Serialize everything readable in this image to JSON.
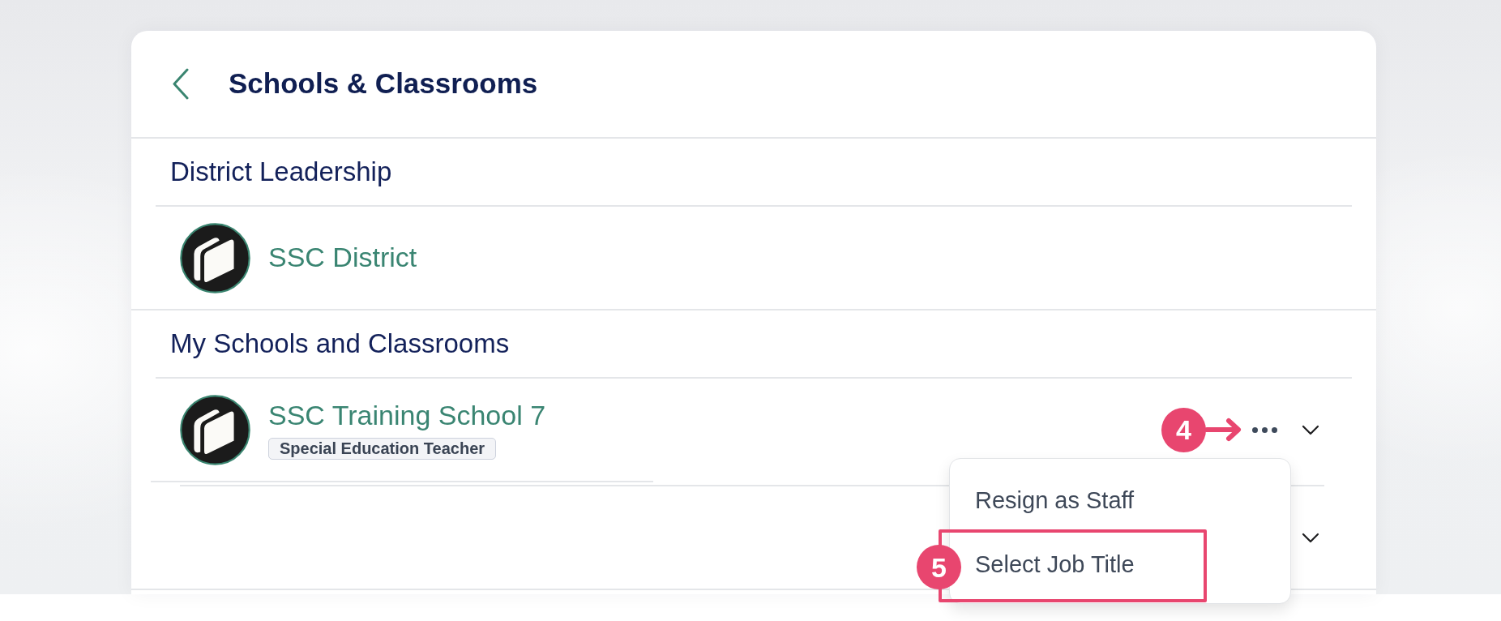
{
  "header": {
    "title": "Schools & Classrooms"
  },
  "sections": [
    {
      "heading": "District Leadership",
      "items": [
        {
          "name": "SSC District",
          "avatar": true,
          "more_menu": false,
          "expandable": false
        }
      ]
    },
    {
      "heading": "My Schools and Classrooms",
      "items": [
        {
          "name": "SSC Training School 7",
          "job_title": "Special Education Teacher",
          "avatar": true,
          "more_menu": true,
          "expandable": true,
          "callout": "4",
          "menu_open": true,
          "menu_items": [
            {
              "label": "Resign as Staff"
            },
            {
              "label": "Select Job Title",
              "callout": "5"
            }
          ]
        },
        {
          "avatar": false,
          "more_menu": false,
          "expandable": true
        }
      ]
    }
  ]
}
